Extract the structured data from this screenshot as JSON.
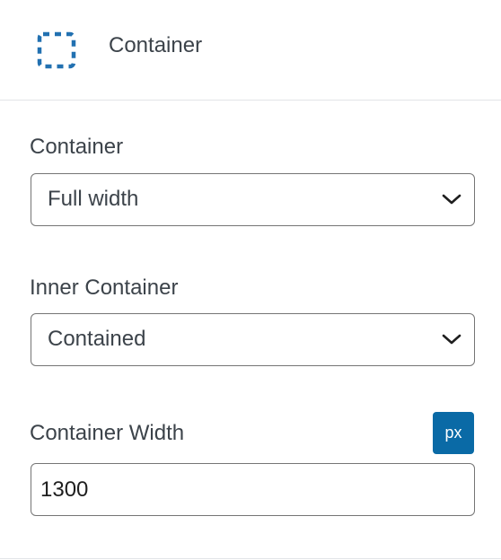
{
  "header": {
    "icon": "container-dashed-icon",
    "title": "Container"
  },
  "fields": {
    "container": {
      "label": "Container",
      "value": "Full width"
    },
    "inner_container": {
      "label": "Inner Container",
      "value": "Contained"
    },
    "container_width": {
      "label": "Container Width",
      "unit": "px",
      "value": "1300"
    }
  },
  "colors": {
    "accent": "#0a6aa6",
    "icon": "#2271b1",
    "text": "#3c434a",
    "border": "#757575"
  }
}
